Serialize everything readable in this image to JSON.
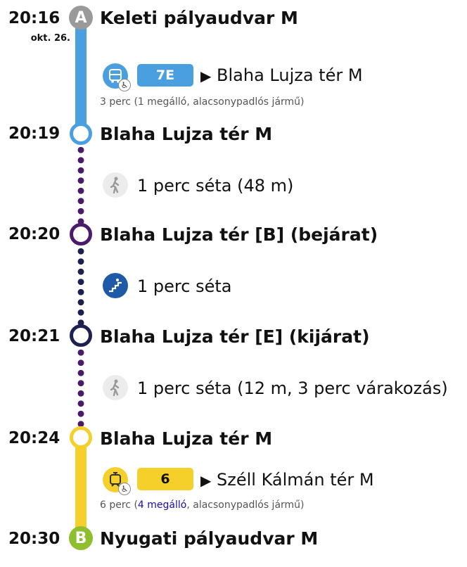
{
  "legs": {
    "start": {
      "time": "20:16",
      "date": "okt. 26.",
      "marker": "A",
      "stop": "Keleti pályaudvar M"
    },
    "bus": {
      "route": "7E",
      "direction": "Blaha Lujza tér M",
      "info": "3 perc (1 megálló, alacsonypadlós jármű)",
      "color": "#4a9fe0",
      "icon": "bus-icon"
    },
    "stop2": {
      "time": "20:19",
      "stop": "Blaha Lujza tér M"
    },
    "walk1": {
      "text": "1 perc séta (48 m)",
      "icon": "walk-icon"
    },
    "stop3": {
      "time": "20:20",
      "stop": "Blaha Lujza tér [B] (bejárat)"
    },
    "walk2": {
      "text": "1 perc séta",
      "icon": "stairs-icon"
    },
    "stop4": {
      "time": "20:21",
      "stop": "Blaha Lujza tér [E] (kijárat)"
    },
    "walk3": {
      "text": "1 perc séta (12 m, 3 perc várakozás)",
      "icon": "walk-icon"
    },
    "stop5": {
      "time": "20:24",
      "stop": "Blaha Lujza tér M"
    },
    "tram": {
      "route": "6",
      "direction": "Széll Kálmán tér M",
      "info_prefix": "6 perc (",
      "info_link": "4 megálló",
      "info_suffix": ", alacsonypadlós jármű)",
      "color": "#f5d02b",
      "icon": "tram-icon"
    },
    "end": {
      "time": "20:30",
      "marker": "B",
      "stop": "Nyugati pályaudvar M"
    }
  },
  "colors": {
    "bus_line": "#4a9fe0",
    "walk_dots": "#4a1a6b",
    "walk_dots_dark": "#1e2050",
    "tram_line": "#f5d02b",
    "start_marker": "#9a9a9a",
    "end_marker": "#8fbf2f"
  }
}
